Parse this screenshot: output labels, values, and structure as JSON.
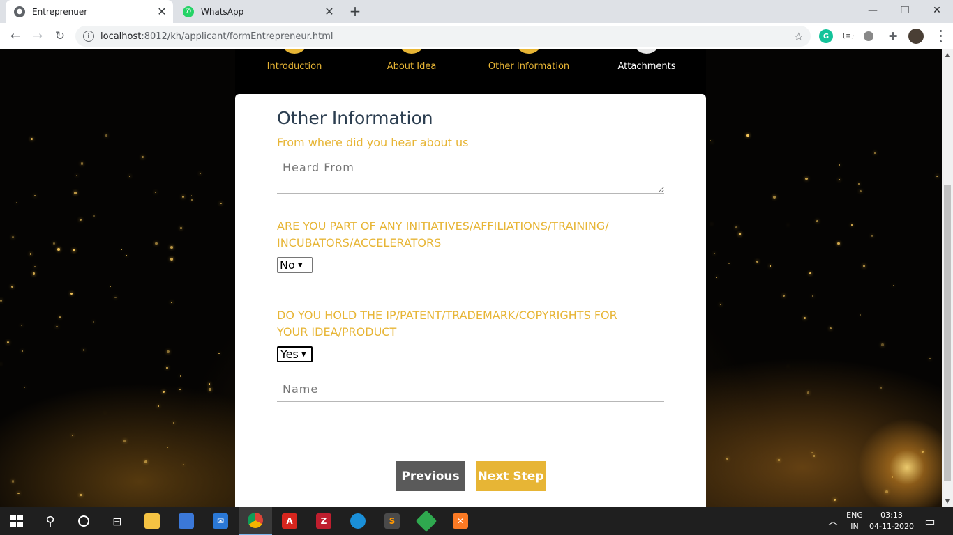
{
  "browser": {
    "tabs": [
      {
        "title": "Entreprenuer",
        "active": true
      },
      {
        "title": "WhatsApp",
        "active": false
      }
    ],
    "url_host": "localhost",
    "url_path": ":8012/kh/applicant/formEntrepreneur.html"
  },
  "steps": [
    {
      "label": "Introduction",
      "color": "#e7b535"
    },
    {
      "label": "About Idea",
      "color": "#e7b535"
    },
    {
      "label": "Other Information",
      "color": "#e7b535"
    },
    {
      "label": "Attachments",
      "color": "#ffffff"
    }
  ],
  "form": {
    "title": "Other Information",
    "heard_question": "From where did you hear about us",
    "heard_placeholder": "Heard From",
    "initiatives_question": "ARE YOU PART OF ANY INITIATIVES/AFFILIATIONS/TRAINING/ INCUBATORS/ACCELERATORS",
    "initiatives_value": "No",
    "ip_question": "DO YOU HOLD THE IP/PATENT/TRADEMARK/COPYRIGHTS FOR YOUR IDEA/PRODUCT",
    "ip_value": "Yes",
    "name_placeholder": "Name",
    "previous_label": "Previous",
    "next_label": "Next Step"
  },
  "colors": {
    "accent": "#e7b535",
    "previous_button": "#5a5a5a",
    "heading": "#2c3e50"
  },
  "taskbar": {
    "lang_top": "ENG",
    "lang_bottom": "IN",
    "time": "03:13",
    "date": "04-11-2020"
  }
}
